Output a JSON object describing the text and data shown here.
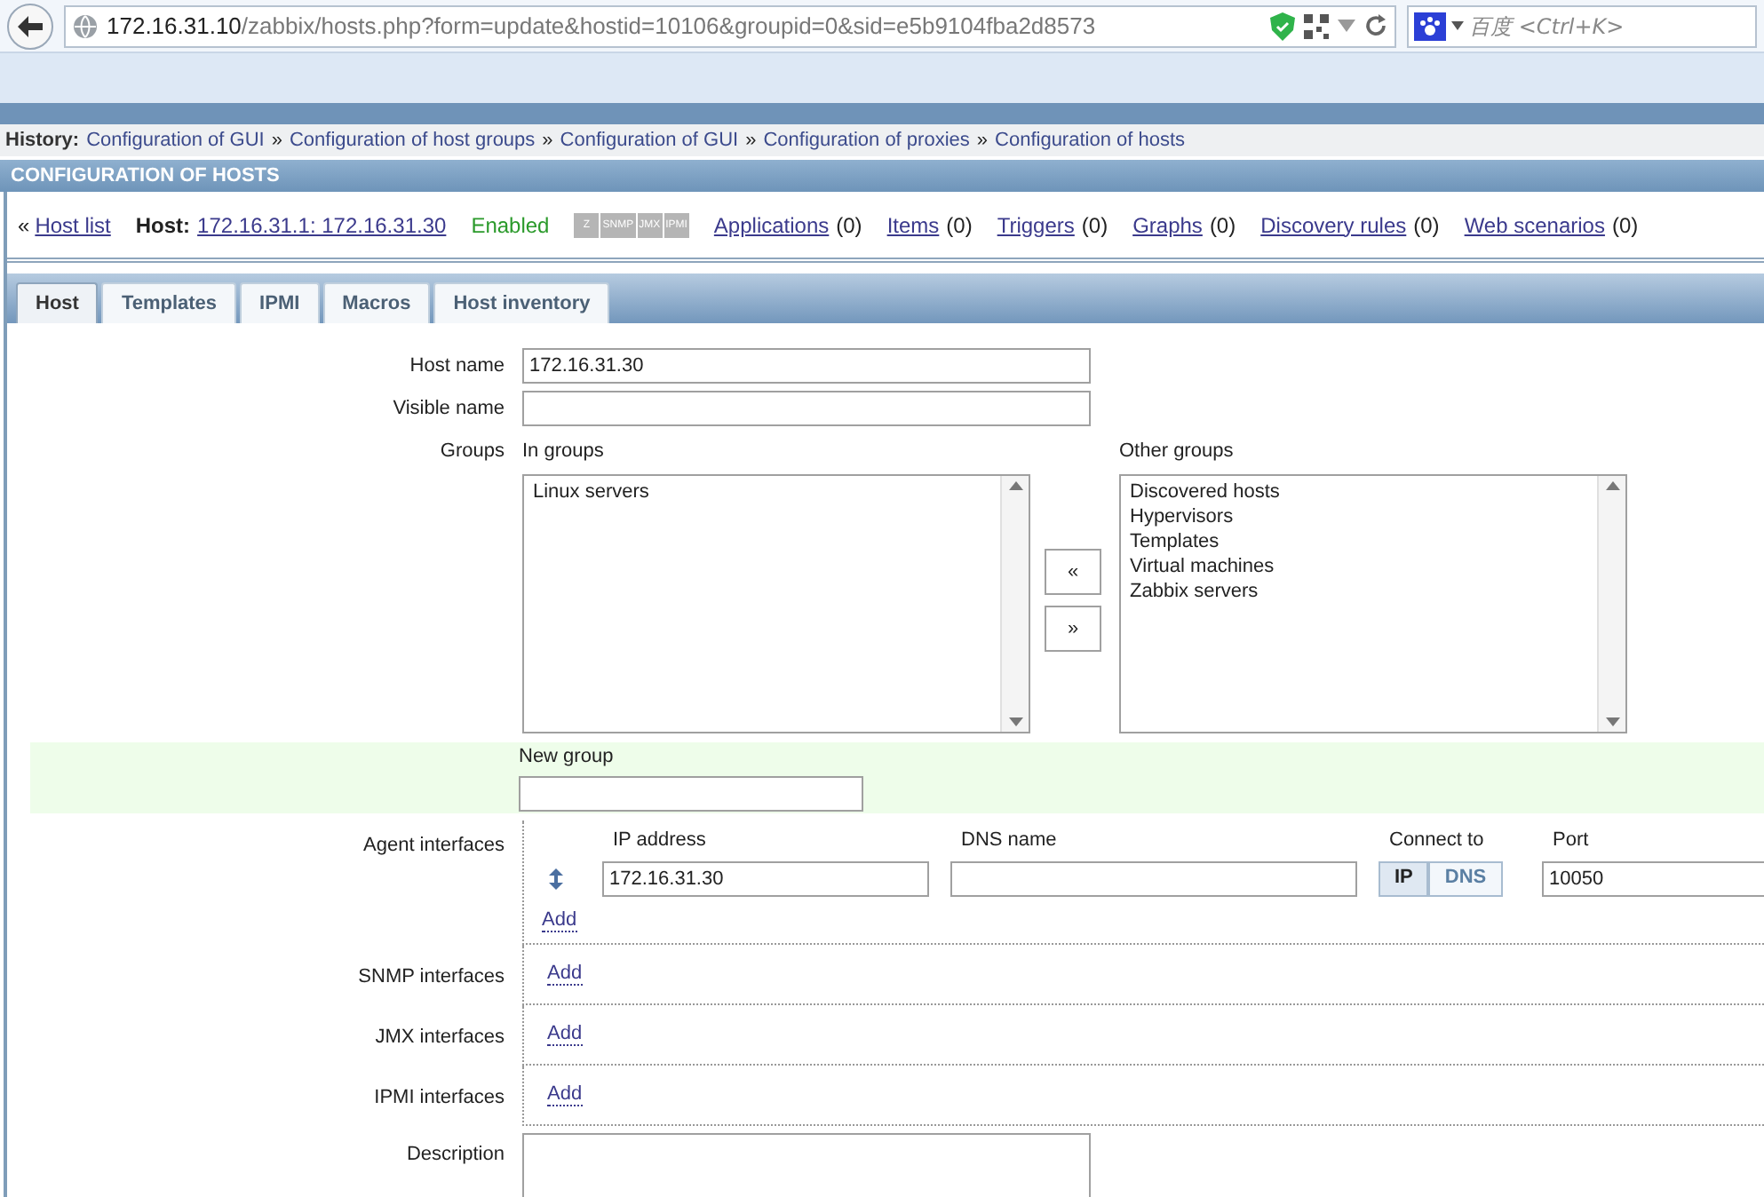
{
  "browser": {
    "url_host": "172.16.31.10",
    "url_path": "/zabbix/hosts.php?form=update&hostid=10106&groupid=0&sid=e5b9104fba2d8573",
    "search_placeholder": "百度 <Ctrl+K>"
  },
  "history": {
    "label": "History:",
    "items": [
      "Configuration of GUI",
      "Configuration of host groups",
      "Configuration of GUI",
      "Configuration of proxies",
      "Configuration of hosts"
    ],
    "separator": "»"
  },
  "page_title": "CONFIGURATION OF HOSTS",
  "summary": {
    "back_mark": "«",
    "back_link": "Host list",
    "host_label": "Host:",
    "host_link": "172.16.31.1: 172.16.31.30",
    "status": "Enabled",
    "availability": [
      {
        "label": "Z"
      },
      {
        "label": "SNMP"
      },
      {
        "label": "JMX"
      },
      {
        "label": "IPMI"
      }
    ],
    "links": [
      {
        "label": "Applications",
        "count": "(0)"
      },
      {
        "label": "Items",
        "count": "(0)"
      },
      {
        "label": "Triggers",
        "count": "(0)"
      },
      {
        "label": "Graphs",
        "count": "(0)"
      },
      {
        "label": "Discovery rules",
        "count": "(0)"
      },
      {
        "label": "Web scenarios",
        "count": "(0)"
      }
    ]
  },
  "tabs": [
    {
      "label": "Host",
      "selected": true
    },
    {
      "label": "Templates",
      "selected": false
    },
    {
      "label": "IPMI",
      "selected": false
    },
    {
      "label": "Macros",
      "selected": false
    },
    {
      "label": "Host inventory",
      "selected": false
    }
  ],
  "form": {
    "host_name": {
      "label": "Host name",
      "value": "172.16.31.30"
    },
    "visible_name": {
      "label": "Visible name"
    },
    "groups": {
      "label": "Groups",
      "in_label": "In groups",
      "in_items": [
        "Linux servers"
      ],
      "other_label": "Other groups",
      "other_items": [
        "Discovered hosts",
        "Hypervisors",
        "Templates",
        "Virtual machines",
        "Zabbix servers"
      ],
      "add_button": "«",
      "remove_button": "»"
    },
    "new_group": {
      "label": "New group"
    },
    "agent": {
      "label": "Agent interfaces",
      "col_ip": "IP address",
      "col_dns": "DNS name",
      "col_connect": "Connect to",
      "col_port": "Port",
      "ip": "172.16.31.30",
      "connect": [
        {
          "label": "IP",
          "selected": true
        },
        {
          "label": "DNS",
          "selected": false
        }
      ],
      "port": "10050",
      "add": "Add"
    },
    "interfaces": [
      {
        "label": "SNMP interfaces",
        "add": "Add"
      },
      {
        "label": "JMX interfaces",
        "add": "Add"
      },
      {
        "label": "IPMI interfaces",
        "add": "Add"
      }
    ],
    "description": {
      "label": "Description"
    }
  }
}
